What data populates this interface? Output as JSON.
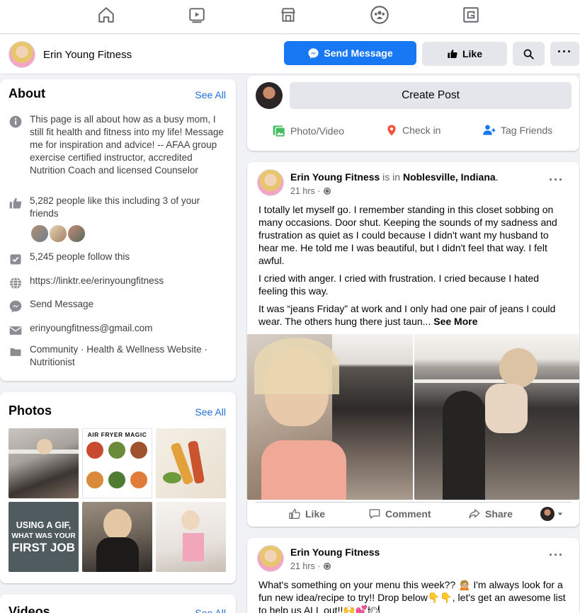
{
  "colors": {
    "brand_blue": "#1877f2",
    "link_blue": "#216fdb",
    "bg": "#f0f2f5"
  },
  "topnav": {
    "icons": [
      "home-icon",
      "watch-icon",
      "marketplace-icon",
      "groups-icon",
      "gaming-icon"
    ]
  },
  "page_header": {
    "name": "Erin Young Fitness",
    "send_message_label": "Send Message",
    "like_label": "Like"
  },
  "about": {
    "title": "About",
    "see_all": "See All",
    "description": "This page is all about how as a busy mom, I still fit health and fitness into my life! Message me for inspiration and advice! -- AFAA group exercise certified instructor, accredited Nutrition Coach and licensed Counselor",
    "likes": "5,282 people like this including 3 of your friends",
    "follows": "5,245 people follow this",
    "website": "https://linktr.ee/erinyoungfitness",
    "send_message": "Send Message",
    "email": "erinyoungfitness@gmail.com",
    "categories": "Community · Health & Wellness Website · Nutritionist"
  },
  "photos": {
    "title": "Photos",
    "see_all": "See All",
    "air_fryer_title": "AIR FRYER MAGIC",
    "gif_text": [
      "USING A GIF,",
      "WHAT WAS YOUR",
      "FIRST JOB"
    ]
  },
  "videos": {
    "title": "Videos",
    "see_all": "See All"
  },
  "composer": {
    "create_post": "Create Post",
    "photo_video": "Photo/Video",
    "check_in": "Check in",
    "tag_friends": "Tag Friends"
  },
  "post1": {
    "author": "Erin Young Fitness",
    "is_in": " is in ",
    "location": "Noblesville, Indiana",
    "location_period": ".",
    "time": "21 hrs ·",
    "p1": "I totally let myself go. I remember standing in this closet sobbing on many occasions. Door shut. Keeping the sounds of my sadness and frustration as quiet as I could because I didn't want my husband to hear me. He told me I was beautiful, but I didn't feel that way. I felt awful.",
    "p2": "I cried with anger. I cried with frustration. I cried because I hated feeling this way.",
    "p3": "It was “jeans Friday” at work and I only had one pair of jeans I could wear. The others hung there just taun...",
    "see_more": "See More",
    "like": "Like",
    "comment": "Comment",
    "share": "Share"
  },
  "post2": {
    "author": "Erin Young Fitness",
    "time": "21 hrs ·",
    "p1": "What's something on your menu this week?? 🙍🏼 I'm always look for a fun new idea/recipe to try!! Drop below👇👇, let's get an awesome list to help us ALL out!!🙌💕🍽"
  }
}
